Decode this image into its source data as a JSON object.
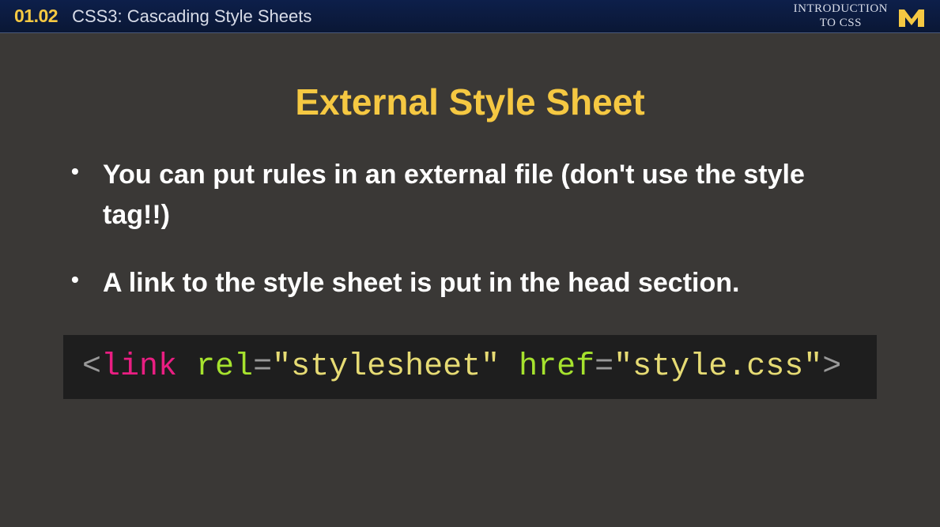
{
  "header": {
    "lesson_number": "01.02",
    "lesson_title": "CSS3: Cascading Style Sheets",
    "course_label_line1": "INTRODUCTION",
    "course_label_line2": "TO CSS"
  },
  "slide": {
    "title": "External Style Sheet",
    "bullets": [
      "You can put rules in an external file (don't use the style tag!!)",
      "A link to the style sheet is put in the head section."
    ],
    "code": {
      "bracket_open": "<",
      "tag": "link",
      "attr1": "rel",
      "equals": "=",
      "value1": "\"stylesheet\"",
      "attr2": "href",
      "value2": "\"style.css\"",
      "bracket_close": ">"
    }
  },
  "colors": {
    "accent": "#f5c842",
    "header_bg": "#0d1f4a",
    "body_bg": "#3a3836",
    "code_bg": "#1e1e1e",
    "code_tag": "#e91e82",
    "code_attr": "#a6e22e",
    "code_value": "#e6db74"
  }
}
